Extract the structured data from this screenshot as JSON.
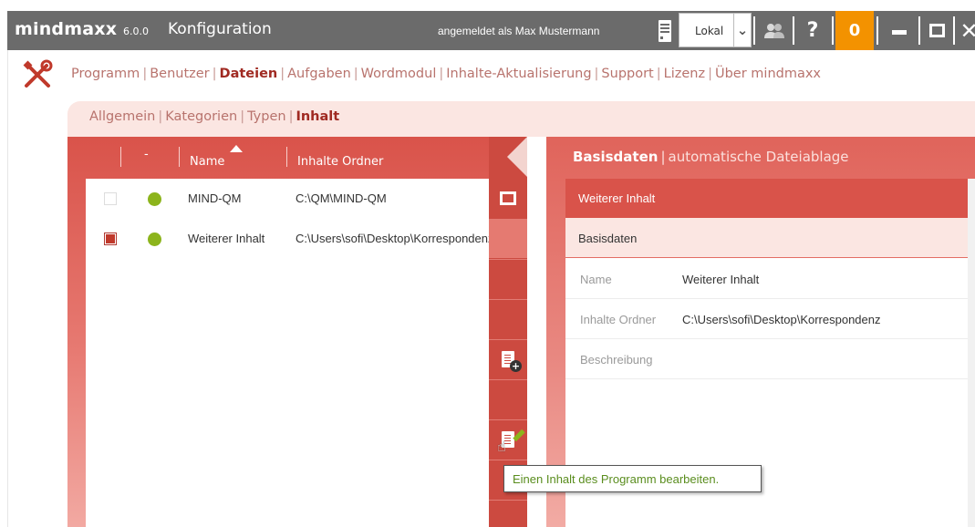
{
  "app": {
    "logo": "mindmaxx",
    "version": "6.0.0",
    "title": "Konfiguration",
    "login_text": "angemeldet als Max Mustermann",
    "server_select": "Lokal",
    "help_label": "?",
    "notification_count": "0"
  },
  "main_nav": {
    "items": [
      {
        "label": "Programm"
      },
      {
        "label": "Benutzer"
      },
      {
        "label": "Dateien",
        "active": true
      },
      {
        "label": "Aufgaben"
      },
      {
        "label": "Wordmodul"
      },
      {
        "label": "Inhalte-Aktualisierung"
      },
      {
        "label": "Support"
      },
      {
        "label": "Lizenz"
      },
      {
        "label": "Über mindmaxx"
      }
    ]
  },
  "sub_nav": {
    "items": [
      {
        "label": "Allgemein"
      },
      {
        "label": "Kategorien"
      },
      {
        "label": "Typen"
      },
      {
        "label": "Inhalt",
        "active": true
      }
    ]
  },
  "list": {
    "columns": {
      "status": "-",
      "name": "Name",
      "folder": "Inhalte Ordner"
    },
    "rows": [
      {
        "checked": false,
        "status_color": "#8cb41c",
        "name": "MIND-QM",
        "folder": "C:\\QM\\MIND-QM"
      },
      {
        "checked": true,
        "status_color": "#8cb41c",
        "name": "Weiterer Inhalt",
        "folder": "C:\\Users\\sofi\\Desktop\\Korrespondenz"
      }
    ]
  },
  "actions": {
    "tooltip": "Einen Inhalt des Programm bearbeiten."
  },
  "detail": {
    "tabs": {
      "active": "Basisdaten",
      "inactive": "automatische Dateiablage"
    },
    "header": "Weiterer Inhalt",
    "section": "Basisdaten",
    "fields": [
      {
        "label": "Name",
        "value": "Weiterer Inhalt"
      },
      {
        "label": "Inhalte Ordner",
        "value": "C:\\Users\\sofi\\Desktop\\Korrespondenz"
      },
      {
        "label": "Beschreibung",
        "value": ""
      }
    ]
  },
  "colors": {
    "accent": "#d9534a",
    "active_text": "#a02a22",
    "status_ok": "#8cb41c",
    "notification": "#f39200"
  }
}
